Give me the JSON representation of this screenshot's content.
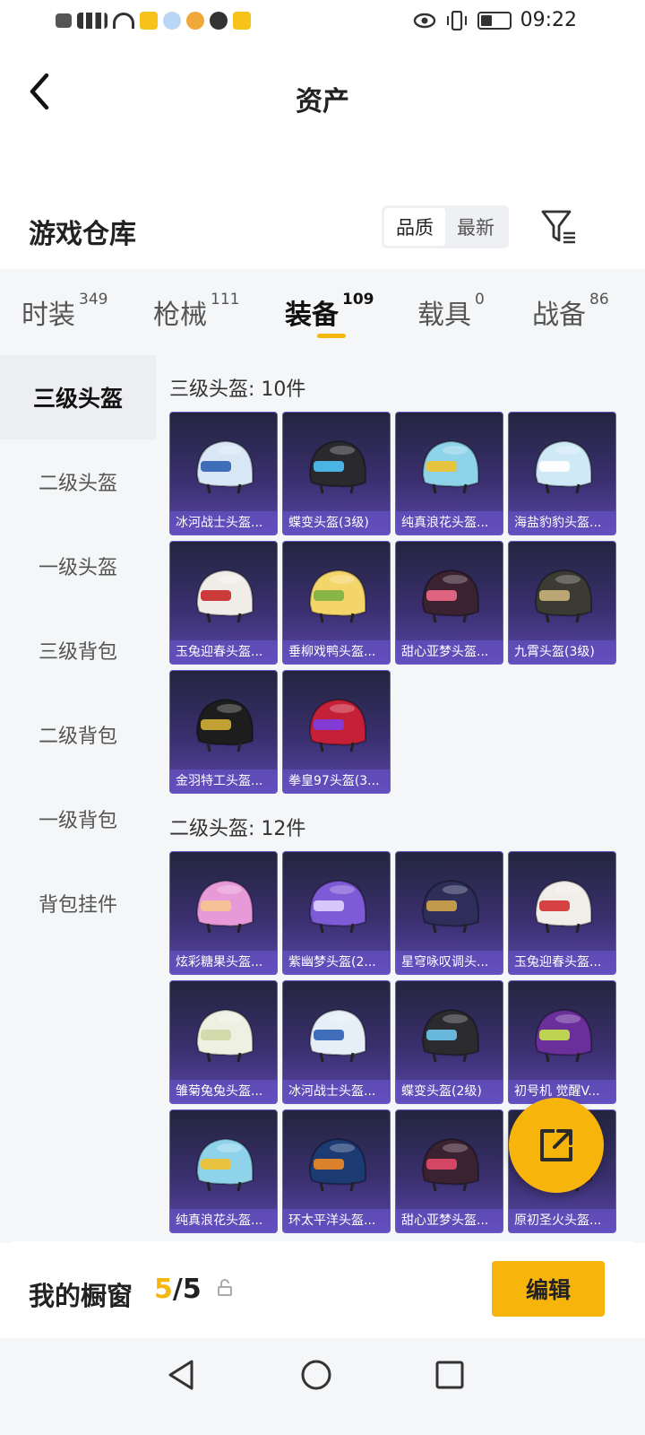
{
  "status_bar": {
    "left_icons": [
      "hd-icon",
      "signal-5g-icon",
      "wifi-icon",
      "app-7-icon",
      "app-qq-icon",
      "app-pinwheel-icon",
      "chat-icon",
      "app-7-icon"
    ],
    "time": "09:22"
  },
  "header": {
    "title": "资产"
  },
  "warehouse": {
    "title": "游戏仓库",
    "sort_options": [
      "品质",
      "最新"
    ],
    "active_sort": "品质"
  },
  "tabs": [
    {
      "label": "时装",
      "count": "349"
    },
    {
      "label": "枪械",
      "count": "111"
    },
    {
      "label": "装备",
      "count": "109",
      "active": true
    },
    {
      "label": "载具",
      "count": "0"
    },
    {
      "label": "战备",
      "count": "86"
    }
  ],
  "sidebar": {
    "items": [
      "三级头盔",
      "二级头盔",
      "一级头盔",
      "三级背包",
      "二级背包",
      "一级背包",
      "背包挂件"
    ],
    "active": "三级头盔"
  },
  "sections": [
    {
      "title": "三级头盔: 10件",
      "items": [
        {
          "name": "冰河战士头盔...",
          "color": "#d9e6f5",
          "accent": "#2f5fb4"
        },
        {
          "name": "蝶变头盔(3级)",
          "color": "#2a2a2e",
          "accent": "#4fc3f7"
        },
        {
          "name": "纯真浪花头盔...",
          "color": "#8fd3ea",
          "accent": "#f2c12e"
        },
        {
          "name": "海盐豹豹头盔...",
          "color": "#cfe9f7",
          "accent": "#ffffff"
        },
        {
          "name": "玉兔迎春头盔...",
          "color": "#f0ece8",
          "accent": "#c62828"
        },
        {
          "name": "垂柳戏鸭头盔...",
          "color": "#f4d56a",
          "accent": "#7cb342"
        },
        {
          "name": "甜心亚梦头盔...",
          "color": "#3a2230",
          "accent": "#ef6a8a"
        },
        {
          "name": "九霄头盔(3级)",
          "color": "#3b3a33",
          "accent": "#c9b47a"
        },
        {
          "name": "金羽特工头盔...",
          "color": "#1d1d1d",
          "accent": "#d4af37"
        },
        {
          "name": "拳皇97头盔(3...",
          "color": "#c62038",
          "accent": "#7b3fe4"
        }
      ]
    },
    {
      "title": "二级头盔: 12件",
      "items": [
        {
          "name": "炫彩糖果头盔...",
          "color": "#e89ad8",
          "accent": "#f6c58f"
        },
        {
          "name": "紫幽梦头盔(2...",
          "color": "#7e5bd6",
          "accent": "#e0d4ff"
        },
        {
          "name": "星穹咏叹调头...",
          "color": "#2d2f5a",
          "accent": "#d4a64a"
        },
        {
          "name": "玉兔迎春头盔...",
          "color": "#f1eeea",
          "accent": "#d32f2f"
        },
        {
          "name": "雏菊兔兔头盔...",
          "color": "#eef0e2",
          "accent": "#cfd8a6"
        },
        {
          "name": "冰河战士头盔...",
          "color": "#e6eef8",
          "accent": "#2f5fb4"
        },
        {
          "name": "蝶变头盔(2级)",
          "color": "#2b2b2e",
          "accent": "#6ec6f0"
        },
        {
          "name": "初号机 觉醒V...",
          "color": "#6b2f9b",
          "accent": "#c8e64a"
        },
        {
          "name": "纯真浪花头盔...",
          "color": "#8fd3ea",
          "accent": "#f2c12e"
        },
        {
          "name": "环太平洋头盔...",
          "color": "#1c3b73",
          "accent": "#f08a24"
        },
        {
          "name": "甜心亚梦头盔...",
          "color": "#3b2230",
          "accent": "#e64a6a"
        },
        {
          "name": "原初圣火头盔...",
          "color": "#b93a2f",
          "accent": "#f7c843"
        }
      ]
    }
  ],
  "fab": {
    "icon": "share-export-icon"
  },
  "showcase": {
    "label": "我的橱窗",
    "current": "5",
    "separator": "/",
    "total": "5",
    "edit_label": "编辑"
  },
  "colors": {
    "accent": "#f7b50c",
    "card_bg_top": "#23253f",
    "card_bg_bottom": "#5846a8"
  }
}
